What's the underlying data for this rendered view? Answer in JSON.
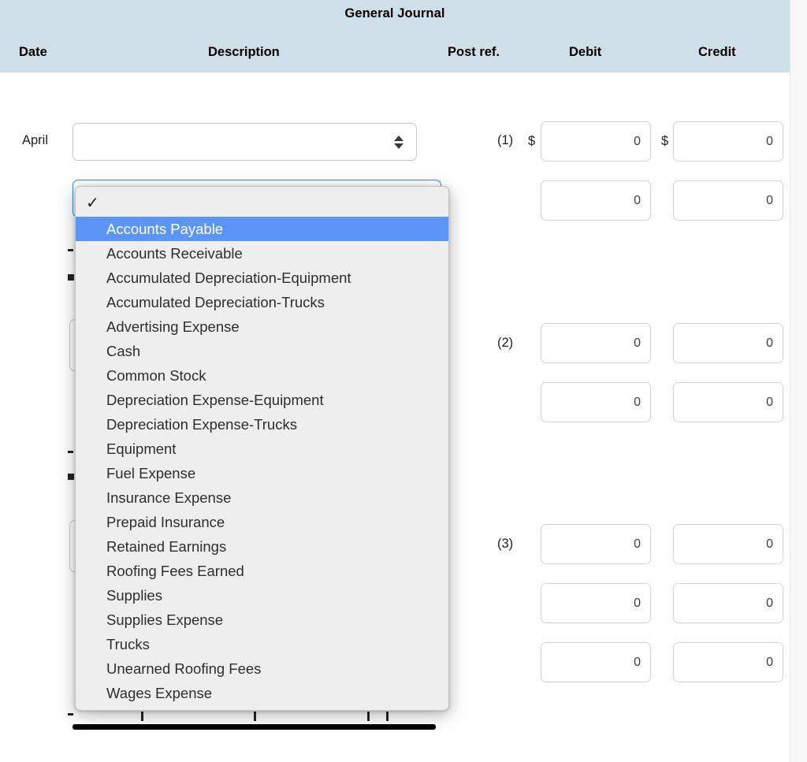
{
  "header": {
    "title": "General Journal",
    "columns": [
      {
        "key": "date",
        "label": "Date"
      },
      {
        "key": "desc",
        "label": "Description"
      },
      {
        "key": "postref",
        "label": "Post ref."
      },
      {
        "key": "debit",
        "label": "Debit"
      },
      {
        "key": "credit",
        "label": "Credit"
      }
    ],
    "band_color": "#cfdfe8"
  },
  "journal": {
    "date_label": "April",
    "entries": [
      {
        "number": "(1)",
        "rows": [
          {
            "dollar_debit": "$",
            "dollar_credit": "$",
            "debit": "0",
            "credit": "0"
          },
          {
            "dollar_debit": "",
            "dollar_credit": "",
            "debit": "0",
            "credit": "0"
          }
        ]
      },
      {
        "number": "(2)",
        "rows": [
          {
            "dollar_debit": "",
            "dollar_credit": "",
            "debit": "0",
            "credit": "0"
          },
          {
            "dollar_debit": "",
            "dollar_credit": "",
            "debit": "0",
            "credit": "0"
          }
        ]
      },
      {
        "number": "(3)",
        "rows": [
          {
            "dollar_debit": "",
            "dollar_credit": "",
            "debit": "0",
            "credit": "0"
          },
          {
            "dollar_debit": "",
            "dollar_credit": "",
            "debit": "0",
            "credit": "0"
          },
          {
            "dollar_debit": "",
            "dollar_credit": "",
            "debit": "0",
            "credit": "0"
          }
        ]
      }
    ],
    "account_select": {
      "value": "",
      "placeholder": ""
    }
  },
  "dropdown": {
    "open": true,
    "checkmark": "✓",
    "selected_index": 1,
    "highlight_color": "#5b95f5",
    "items": [
      "",
      "Accounts Payable",
      "Accounts Receivable",
      "Accumulated Depreciation-Equipment",
      "Accumulated Depreciation-Trucks",
      "Advertising Expense",
      "Cash",
      "Common Stock",
      "Depreciation Expense-Equipment",
      "Depreciation Expense-Trucks",
      "Equipment",
      "Fuel Expense",
      "Insurance Expense",
      "Prepaid Insurance",
      "Retained Earnings",
      "Roofing Fees Earned",
      "Supplies",
      "Supplies Expense",
      "Trucks",
      "Unearned Roofing Fees",
      "Wages Expense"
    ]
  }
}
